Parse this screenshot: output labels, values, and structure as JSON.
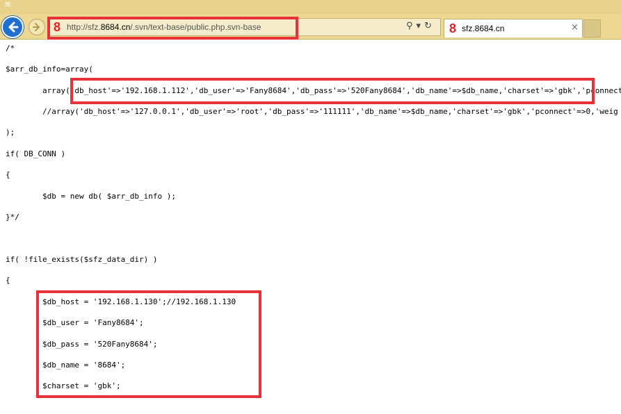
{
  "window": {
    "menu_glyph": "≡"
  },
  "toolbar": {
    "back_icon": "back-arrow-icon",
    "forward_icon": "forward-arrow-icon",
    "address": {
      "favicon": "8",
      "url_prefix": "http://sfz.",
      "url_host": "8684.cn",
      "url_path": "/.svn/text-base/public.php.svn-base"
    },
    "address_icons": [
      "⚲",
      "▾",
      "↻"
    ]
  },
  "tab": {
    "favicon": "8",
    "title": "sfz.8684.cn",
    "close": "×"
  },
  "code": {
    "lines": [
      "/*",
      "$arr_db_info=array(",
      "        array('db_host'=>'192.168.1.112','db_user'=>'Fany8684','db_pass'=>'520Fany8684','db_name'=>$db_name,'charset'=>'gbk','pconnect",
      "        //array('db_host'=>'127.0.0.1','db_user'=>'root','db_pass'=>'111111','db_name'=>$db_name,'charset'=>'gbk','pconnect'=>0,'weig",
      ");",
      "if( DB_CONN )",
      "{",
      "        $db = new db( $arr_db_info );",
      "}*/",
      "if( !file_exists($sfz_data_dir) )",
      "{",
      "        $db_host = '192.168.1.130';//192.168.1.130",
      "        $db_user = 'Fany8684';",
      "        $db_pass = '520Fany8684';",
      "        $db_name = '8684';",
      "        $charset = 'gbk';"
    ]
  },
  "colors": {
    "highlight_border": "#e8323a",
    "toolbar_bg": "#ecd891",
    "back_button": "#1e6fd0"
  }
}
